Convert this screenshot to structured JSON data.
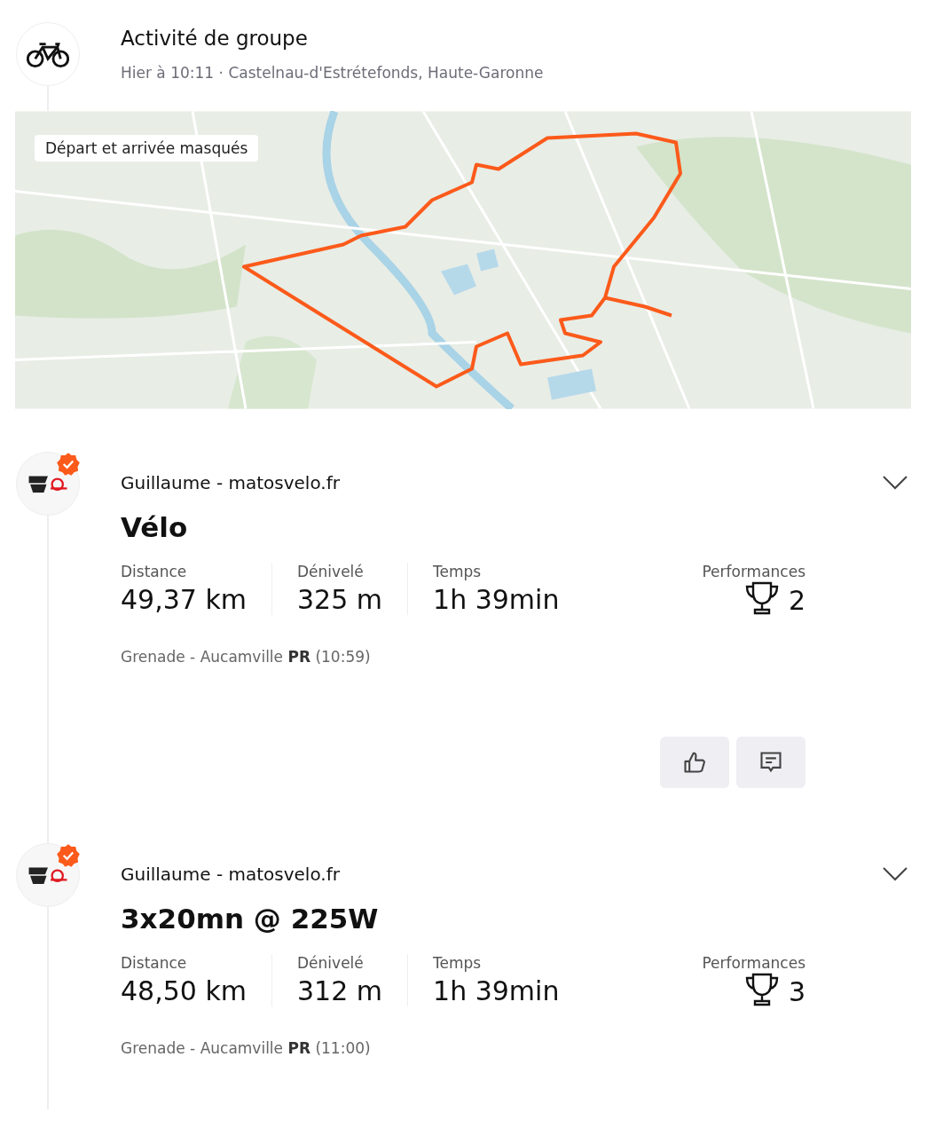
{
  "group": {
    "title": "Activité de groupe",
    "subtitle": "Hier à 10:11 · Castelnau-d'Estrétefonds, Haute-Garonne"
  },
  "map": {
    "kind": "picture",
    "badge": "Départ et arrivée masqués"
  },
  "activities": [
    {
      "athlete": "Guillaume - matosvelo.fr",
      "verified": true,
      "title": "Vélo",
      "stats": [
        {
          "label": "Distance",
          "value": "49,37 km"
        },
        {
          "label": "Dénivelé",
          "value": "325 m"
        },
        {
          "label": "Temps",
          "value": "1h 39min"
        }
      ],
      "performances": {
        "label": "Performances",
        "count": "2"
      },
      "segment": "Grenade - Aucamville **PR** (10:59)",
      "buttons": [
        {
          "kind": "like"
        },
        {
          "kind": "comment"
        }
      ]
    },
    {
      "athlete": "Guillaume - matosvelo.fr",
      "verified": true,
      "title": "3x20mn @ 225W",
      "stats": [
        {
          "label": "Distance",
          "value": "48,50 km"
        },
        {
          "label": "Dénivelé",
          "value": "312 m"
        },
        {
          "label": "Temps",
          "value": "1h 39min"
        }
      ],
      "performances": {
        "label": "Performances",
        "count": "3"
      },
      "segment": "Grenade - Aucamville **PR** (11:00)"
    }
  ]
}
